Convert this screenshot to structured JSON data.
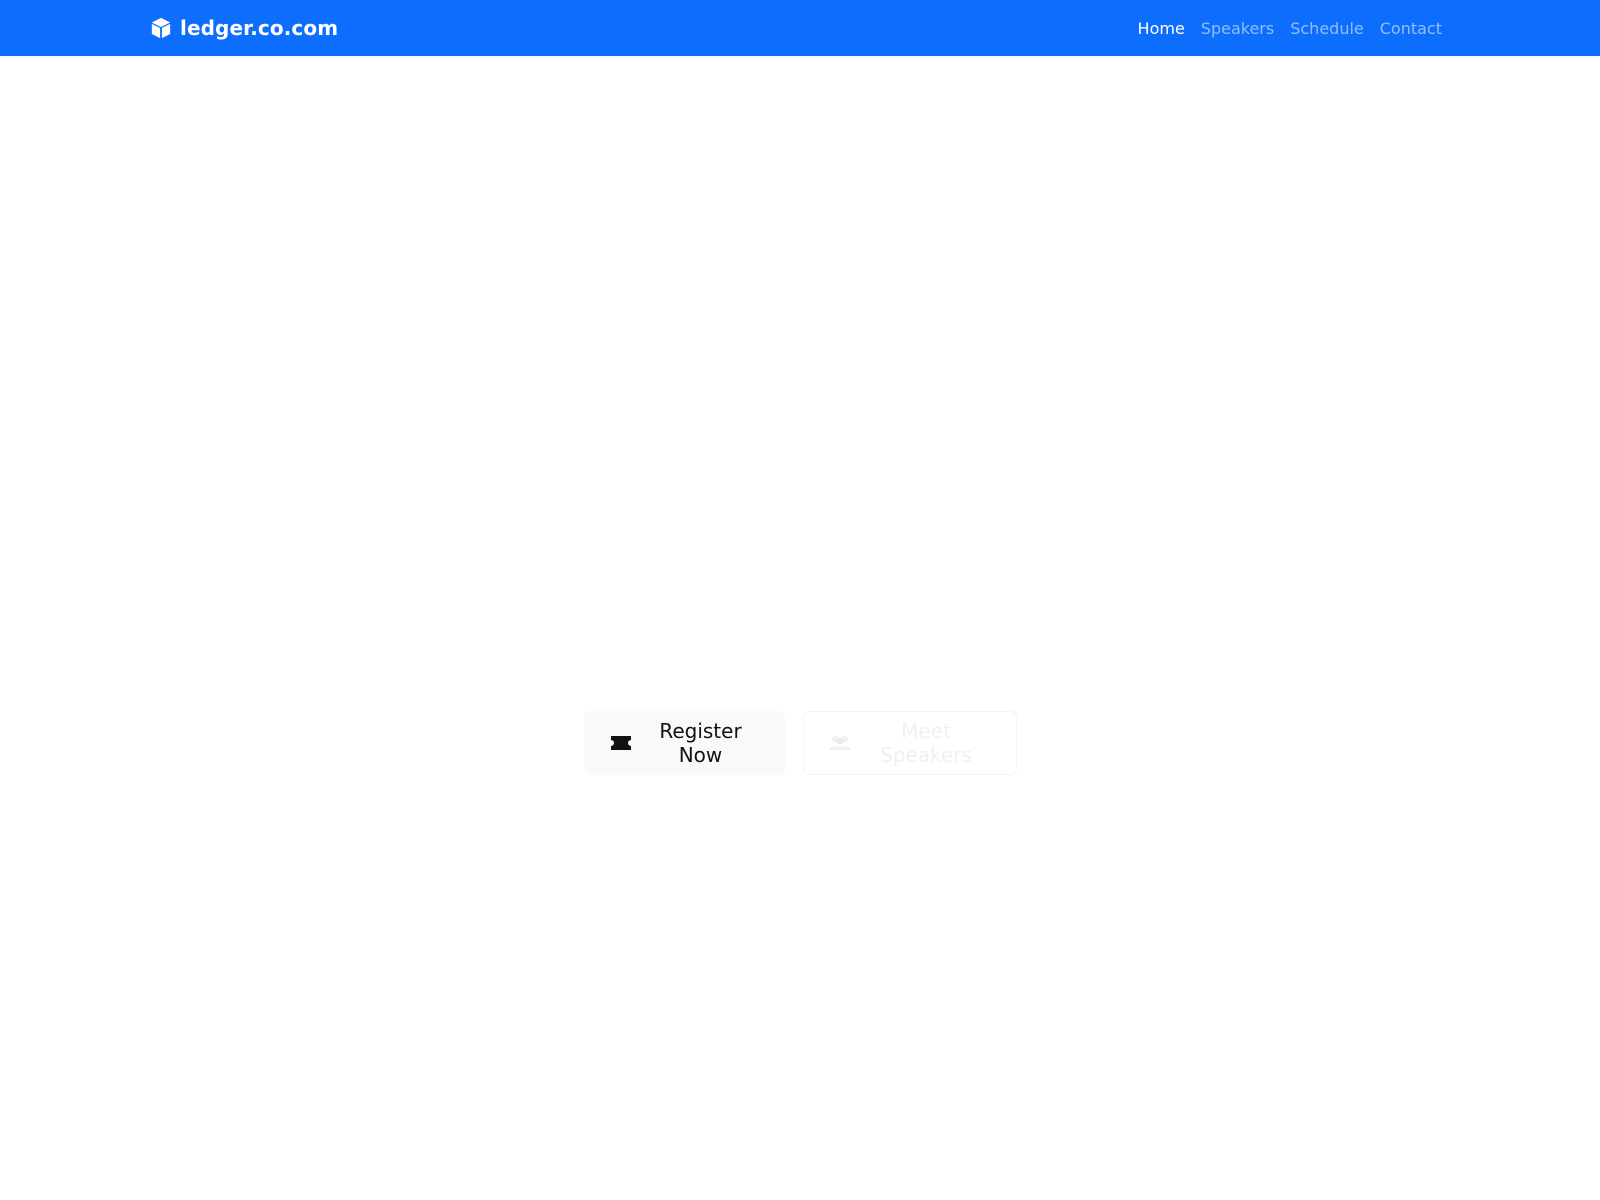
{
  "navbar": {
    "brand": {
      "icon": "cube-icon",
      "text": "ledger.co.com"
    },
    "links": [
      {
        "label": "Home",
        "active": true
      },
      {
        "label": "Speakers",
        "active": false
      },
      {
        "label": "Schedule",
        "active": false
      },
      {
        "label": "Contact",
        "active": false
      }
    ],
    "colors": {
      "background": "#0d6efd",
      "active_link": "#ffffff"
    }
  },
  "hero": {
    "buttons": {
      "register": {
        "icon": "ticket-icon",
        "label": "Register Now"
      },
      "speakers": {
        "icon": "users-icon",
        "label": "Meet Speakers"
      }
    }
  }
}
